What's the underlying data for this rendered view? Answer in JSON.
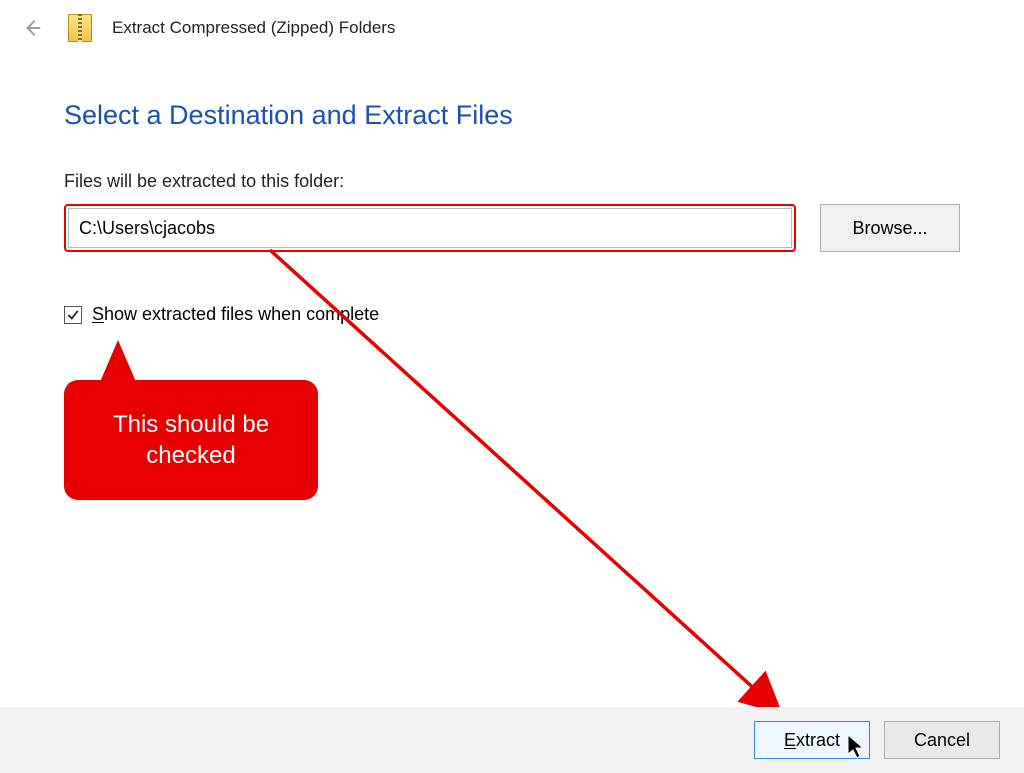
{
  "header": {
    "title": "Extract Compressed (Zipped) Folders"
  },
  "main": {
    "heading": "Select a Destination and Extract Files",
    "folder_label": "Files will be extracted to this folder:",
    "path_value": "C:\\Users\\cjacobs",
    "browse_label": "Browse...",
    "checkbox_prefix": "S",
    "checkbox_rest": "how extracted files when complete",
    "checkbox_checked": true
  },
  "annotation": {
    "callout_text": "This should be checked"
  },
  "footer": {
    "extract_prefix": "E",
    "extract_rest": "xtract",
    "cancel_label": "Cancel"
  }
}
